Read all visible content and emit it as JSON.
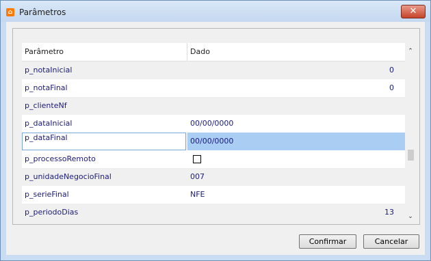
{
  "window": {
    "title": "Parâmetros",
    "app_icon": "app-logo-icon",
    "close_symbol": "✕"
  },
  "grid": {
    "headers": [
      "Parâmetro",
      "Dado"
    ],
    "rows": [
      {
        "name": "p_notaInicial",
        "value": "0"
      },
      {
        "name": "p_notaFinal",
        "value": "0"
      },
      {
        "name": "p_clienteNf",
        "value": ""
      },
      {
        "name": "p_dataInicial",
        "value": "00/00/0000"
      },
      {
        "name": "p_dataFinal",
        "value": "00/00/0000"
      },
      {
        "name": "p_processoRemoto",
        "value": "",
        "checkbox": false
      },
      {
        "name": "p_unidadeNegocioFinal",
        "value": "007"
      },
      {
        "name": "p_serieFinal",
        "value": "NFE"
      },
      {
        "name": "p_periodoDias",
        "value": "13"
      }
    ],
    "selected_row": "p_dataFinal"
  },
  "buttons": {
    "confirm": "Confirmar",
    "cancel": "Cancelar"
  },
  "scrollbar": {
    "up_symbol": "⌃",
    "down_symbol": "⌄"
  },
  "colors": {
    "selection": "#a9cdf3",
    "text": "#1a1a7a"
  }
}
